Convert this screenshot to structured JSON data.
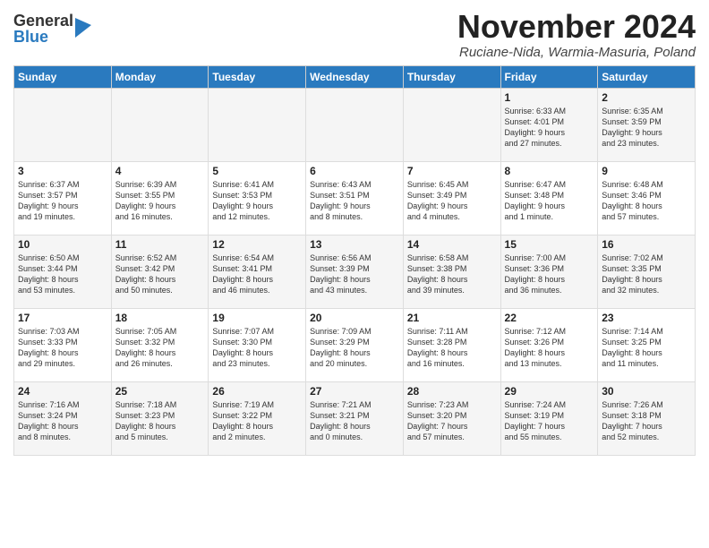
{
  "header": {
    "logo_general": "General",
    "logo_blue": "Blue",
    "month_title": "November 2024",
    "location": "Ruciane-Nida, Warmia-Masuria, Poland"
  },
  "weekdays": [
    "Sunday",
    "Monday",
    "Tuesday",
    "Wednesday",
    "Thursday",
    "Friday",
    "Saturday"
  ],
  "weeks": [
    [
      {
        "day": "",
        "info": ""
      },
      {
        "day": "",
        "info": ""
      },
      {
        "day": "",
        "info": ""
      },
      {
        "day": "",
        "info": ""
      },
      {
        "day": "",
        "info": ""
      },
      {
        "day": "1",
        "info": "Sunrise: 6:33 AM\nSunset: 4:01 PM\nDaylight: 9 hours\nand 27 minutes."
      },
      {
        "day": "2",
        "info": "Sunrise: 6:35 AM\nSunset: 3:59 PM\nDaylight: 9 hours\nand 23 minutes."
      }
    ],
    [
      {
        "day": "3",
        "info": "Sunrise: 6:37 AM\nSunset: 3:57 PM\nDaylight: 9 hours\nand 19 minutes."
      },
      {
        "day": "4",
        "info": "Sunrise: 6:39 AM\nSunset: 3:55 PM\nDaylight: 9 hours\nand 16 minutes."
      },
      {
        "day": "5",
        "info": "Sunrise: 6:41 AM\nSunset: 3:53 PM\nDaylight: 9 hours\nand 12 minutes."
      },
      {
        "day": "6",
        "info": "Sunrise: 6:43 AM\nSunset: 3:51 PM\nDaylight: 9 hours\nand 8 minutes."
      },
      {
        "day": "7",
        "info": "Sunrise: 6:45 AM\nSunset: 3:49 PM\nDaylight: 9 hours\nand 4 minutes."
      },
      {
        "day": "8",
        "info": "Sunrise: 6:47 AM\nSunset: 3:48 PM\nDaylight: 9 hours\nand 1 minute."
      },
      {
        "day": "9",
        "info": "Sunrise: 6:48 AM\nSunset: 3:46 PM\nDaylight: 8 hours\nand 57 minutes."
      }
    ],
    [
      {
        "day": "10",
        "info": "Sunrise: 6:50 AM\nSunset: 3:44 PM\nDaylight: 8 hours\nand 53 minutes."
      },
      {
        "day": "11",
        "info": "Sunrise: 6:52 AM\nSunset: 3:42 PM\nDaylight: 8 hours\nand 50 minutes."
      },
      {
        "day": "12",
        "info": "Sunrise: 6:54 AM\nSunset: 3:41 PM\nDaylight: 8 hours\nand 46 minutes."
      },
      {
        "day": "13",
        "info": "Sunrise: 6:56 AM\nSunset: 3:39 PM\nDaylight: 8 hours\nand 43 minutes."
      },
      {
        "day": "14",
        "info": "Sunrise: 6:58 AM\nSunset: 3:38 PM\nDaylight: 8 hours\nand 39 minutes."
      },
      {
        "day": "15",
        "info": "Sunrise: 7:00 AM\nSunset: 3:36 PM\nDaylight: 8 hours\nand 36 minutes."
      },
      {
        "day": "16",
        "info": "Sunrise: 7:02 AM\nSunset: 3:35 PM\nDaylight: 8 hours\nand 32 minutes."
      }
    ],
    [
      {
        "day": "17",
        "info": "Sunrise: 7:03 AM\nSunset: 3:33 PM\nDaylight: 8 hours\nand 29 minutes."
      },
      {
        "day": "18",
        "info": "Sunrise: 7:05 AM\nSunset: 3:32 PM\nDaylight: 8 hours\nand 26 minutes."
      },
      {
        "day": "19",
        "info": "Sunrise: 7:07 AM\nSunset: 3:30 PM\nDaylight: 8 hours\nand 23 minutes."
      },
      {
        "day": "20",
        "info": "Sunrise: 7:09 AM\nSunset: 3:29 PM\nDaylight: 8 hours\nand 20 minutes."
      },
      {
        "day": "21",
        "info": "Sunrise: 7:11 AM\nSunset: 3:28 PM\nDaylight: 8 hours\nand 16 minutes."
      },
      {
        "day": "22",
        "info": "Sunrise: 7:12 AM\nSunset: 3:26 PM\nDaylight: 8 hours\nand 13 minutes."
      },
      {
        "day": "23",
        "info": "Sunrise: 7:14 AM\nSunset: 3:25 PM\nDaylight: 8 hours\nand 11 minutes."
      }
    ],
    [
      {
        "day": "24",
        "info": "Sunrise: 7:16 AM\nSunset: 3:24 PM\nDaylight: 8 hours\nand 8 minutes."
      },
      {
        "day": "25",
        "info": "Sunrise: 7:18 AM\nSunset: 3:23 PM\nDaylight: 8 hours\nand 5 minutes."
      },
      {
        "day": "26",
        "info": "Sunrise: 7:19 AM\nSunset: 3:22 PM\nDaylight: 8 hours\nand 2 minutes."
      },
      {
        "day": "27",
        "info": "Sunrise: 7:21 AM\nSunset: 3:21 PM\nDaylight: 8 hours\nand 0 minutes."
      },
      {
        "day": "28",
        "info": "Sunrise: 7:23 AM\nSunset: 3:20 PM\nDaylight: 7 hours\nand 57 minutes."
      },
      {
        "day": "29",
        "info": "Sunrise: 7:24 AM\nSunset: 3:19 PM\nDaylight: 7 hours\nand 55 minutes."
      },
      {
        "day": "30",
        "info": "Sunrise: 7:26 AM\nSunset: 3:18 PM\nDaylight: 7 hours\nand 52 minutes."
      }
    ]
  ]
}
